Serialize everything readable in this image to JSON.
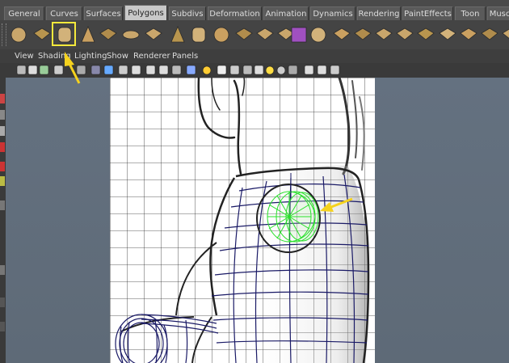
{
  "shelf_tabs": [
    {
      "label": "General",
      "active": false
    },
    {
      "label": "Curves",
      "active": false
    },
    {
      "label": "Surfaces",
      "active": false
    },
    {
      "label": "Polygons",
      "active": true
    },
    {
      "label": "Subdivs",
      "active": false
    },
    {
      "label": "Deformation",
      "active": false
    },
    {
      "label": "Animation",
      "active": false
    },
    {
      "label": "Dynamics",
      "active": false
    },
    {
      "label": "Rendering",
      "active": false
    },
    {
      "label": "PaintEffects",
      "active": false
    },
    {
      "label": "Toon",
      "active": false
    },
    {
      "label": "Muscle",
      "active": false
    }
  ],
  "shelf_icons": [
    "poly-sphere-icon",
    "poly-cube-icon",
    "poly-cylinder-icon",
    "poly-cone-icon",
    "poly-plane-icon",
    "poly-torus-icon",
    "poly-prism-icon",
    "poly-pyramid-icon",
    "poly-pipe-icon",
    "poly-soccer-ball-icon",
    "combine-icon",
    "separate-icon",
    "extract-icon",
    "booleans-icon",
    "smooth-icon",
    "cube-map-icon",
    "append-to-polygon-icon",
    "split-polygon-icon",
    "insert-edge-loop-icon",
    "offset-edge-loop-icon",
    "bevel-icon",
    "extrude-icon",
    "merge-vertices-icon",
    "wedge-face-icon",
    "poke-face-icon",
    "flip-triangle-edge-icon",
    "keep-faces-together-icon"
  ],
  "panel_menu": [
    "View",
    "Shading",
    "Lighting",
    "Show",
    "Renderer",
    "Panels"
  ],
  "panel_toolbar_icons": [
    "select-camera-icon",
    "camera-attributes-icon",
    "bookmarks-icon",
    "image-plane-icon",
    "grid-icon",
    "wireframe-icon",
    "smooth-shade-icon",
    "bounding-box-icon",
    "textured-icon",
    "use-default-light-icon",
    "shadows-icon",
    "isolate-select-icon",
    "xray-icon",
    "xray-joints-icon",
    "high-quality-icon",
    "resolution-gate-icon",
    "safe-action-icon",
    "gate-mask-icon",
    "film-gate-icon",
    "field-chart-icon",
    "ambient-occlusion-icon",
    "motion-blur-icon",
    "anti-aliasing-icon",
    "depth-of-field-icon"
  ],
  "annotations": {
    "arrow_color": "#f5d21e",
    "highlight_color": "#f5e93c"
  },
  "colors": {
    "wireframe": "#1a1a66",
    "selected_wireframe": "#29e12b",
    "grid_line": "#222222",
    "viewport_bg": "#647180"
  }
}
